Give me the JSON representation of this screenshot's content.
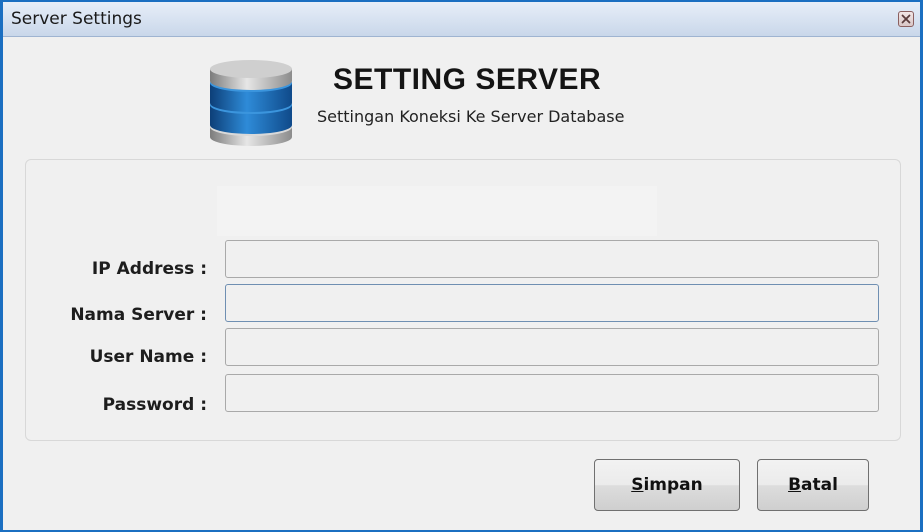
{
  "window": {
    "title": "Server Settings"
  },
  "header": {
    "title": "SETTING SERVER",
    "subtitle": "Settingan Koneksi Ke Server Database",
    "icon": "database-icon"
  },
  "form": {
    "fields": [
      {
        "label": "IP Address :",
        "value": ""
      },
      {
        "label": "Nama Server :",
        "value": ""
      },
      {
        "label": "User Name :",
        "value": ""
      },
      {
        "label": "Password :",
        "value": ""
      }
    ]
  },
  "buttons": {
    "save": {
      "mnemonic": "S",
      "rest": "impan"
    },
    "cancel": {
      "mnemonic": "B",
      "rest": "atal"
    }
  },
  "colors": {
    "window_border": "#1b6fc1",
    "db_icon_blue": "#1f6fb8"
  }
}
